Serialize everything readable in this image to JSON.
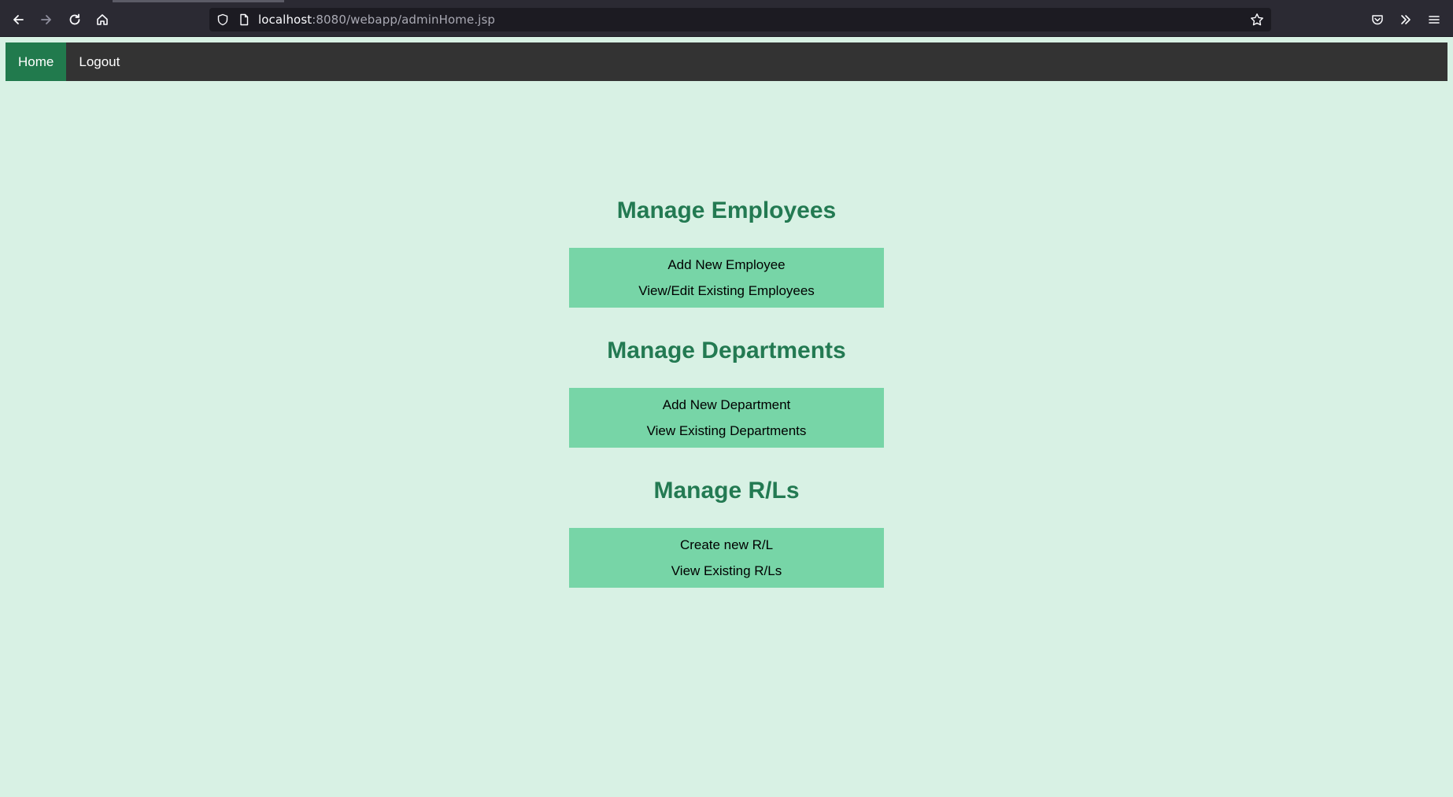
{
  "browser": {
    "url_host": "localhost",
    "url_rest": ":8080/webapp/adminHome.jsp"
  },
  "nav": {
    "home_label": "Home",
    "logout_label": "Logout"
  },
  "sections": [
    {
      "title": "Manage Employees",
      "actions": [
        "Add New Employee",
        "View/Edit Existing Employees"
      ]
    },
    {
      "title": "Manage Departments",
      "actions": [
        "Add New Department",
        "View Existing Departments"
      ]
    },
    {
      "title": "Manage R/Ls",
      "actions": [
        "Create new R/L",
        "View Existing R/Ls"
      ]
    }
  ],
  "colors": {
    "page_bg": "#d8f1e4",
    "nav_bg": "#333333",
    "nav_active": "#217a4d",
    "title": "#237a52",
    "button_bg": "#77d5a7"
  }
}
